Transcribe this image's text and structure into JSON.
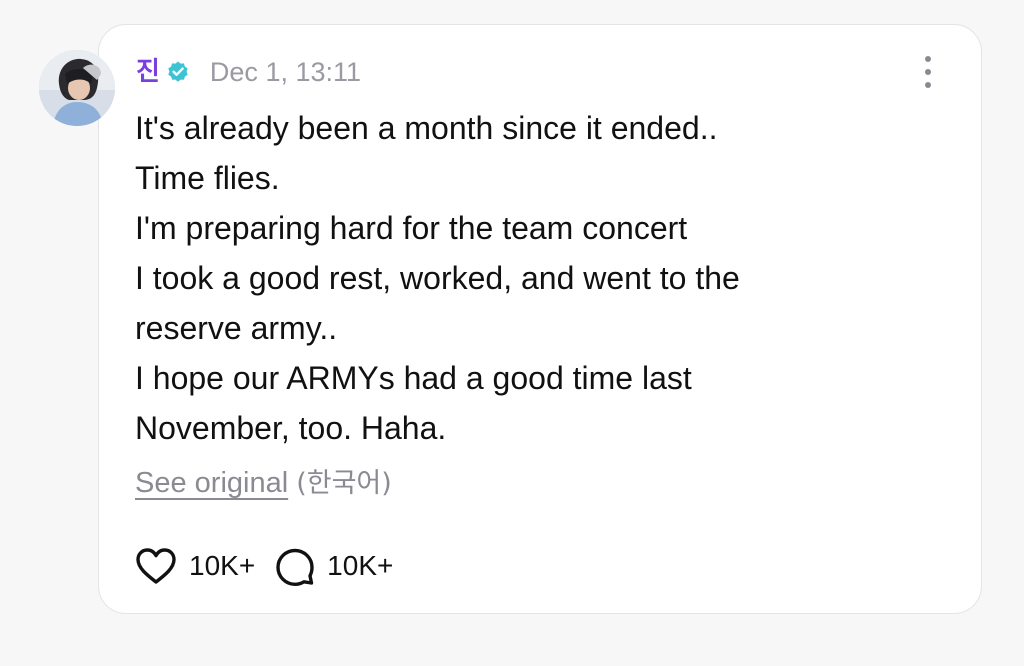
{
  "post": {
    "author": "진",
    "timestamp": "Dec 1, 13:11",
    "lines": [
      "It's already been a month since it ended..",
      "Time flies.",
      "I'm preparing hard for the team concert",
      "I took a good rest, worked, and went to the",
      "reserve army..",
      "I hope our ARMYs had a good time last",
      "November, too. Haha."
    ],
    "translation": {
      "see_original_label": "See original",
      "language_label": "(한국어)"
    },
    "likes": "10K+",
    "comments": "10K+"
  },
  "icons": {
    "verified": "verified-badge-icon",
    "more": "more-vertical-icon",
    "like": "heart-icon",
    "comment": "comment-bubble-icon"
  },
  "colors": {
    "author": "#7b3fe0",
    "verified": "#3ec3d5",
    "timestamp": "#9a9aa2",
    "text": "#111111",
    "muted": "#8a8a92",
    "card_border": "#e3e3e8"
  }
}
